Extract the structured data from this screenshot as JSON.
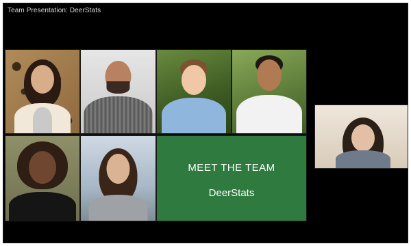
{
  "window": {
    "title": "Team Presentation: DeerStats"
  },
  "slide": {
    "title": "MEET THE TEAM",
    "subtitle": "DeerStats"
  },
  "participants": [
    {
      "role": "video-tile",
      "background": "leopard-print"
    },
    {
      "role": "video-tile",
      "background": "light-gray"
    },
    {
      "role": "video-tile",
      "background": "green-foliage"
    },
    {
      "role": "video-tile",
      "background": "green-foliage"
    },
    {
      "role": "video-tile",
      "background": "olive"
    },
    {
      "role": "video-tile",
      "background": "sky"
    },
    {
      "role": "self-view",
      "background": "room"
    }
  ],
  "colors": {
    "frame": "#000000",
    "slide_bg": "#2f7a3f",
    "slide_text": "#ffffff",
    "title_text": "#d8d8d8"
  }
}
